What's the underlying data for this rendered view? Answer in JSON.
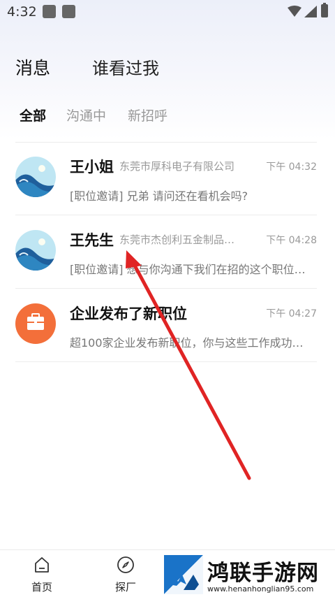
{
  "status_bar": {
    "time": "4:32"
  },
  "header": {
    "tab_messages": "消息",
    "tab_who_viewed": "谁看过我"
  },
  "subtabs": [
    "全部",
    "沟通中",
    "新招呼"
  ],
  "messages": [
    {
      "name": "王小姐",
      "company": "东莞市厚科电子有限公司",
      "time": "下午 04:32",
      "preview": "[职位邀请] 兄弟 请问还在看机会吗?"
    },
    {
      "name": "王先生",
      "company": "东莞市杰创利五金制品…",
      "time": "下午 04:28",
      "preview": "[职位邀请] 想与你沟通下我们在招的这个职位…"
    },
    {
      "name": "企业发布了新职位",
      "company": "",
      "time": "下午 04:27",
      "preview": "超100家企业发布新职位，你与这些工作成功…"
    }
  ],
  "bottom_nav": {
    "home": "首页",
    "discover": "探厂"
  },
  "watermark": {
    "text": "鸿联手游网",
    "url": "www.henanhonglian95.com"
  },
  "colors": {
    "accent_orange": "#f36f3a",
    "arrow_red": "#e02424",
    "avatar_sky": "#bfe6f3",
    "avatar_sea": "#1f5f9c"
  }
}
